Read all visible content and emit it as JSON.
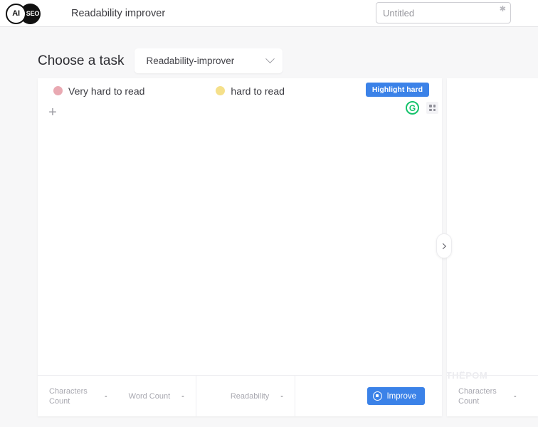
{
  "header": {
    "logo_left": "AI",
    "logo_right": "SEO",
    "title": "Readability improver",
    "document_title_value": "",
    "document_title_placeholder": "Untitled",
    "favorite_icon": "✱"
  },
  "task": {
    "label": "Choose a task",
    "selected": "Readability-improver",
    "dropdown_icon": "chevron-down-icon"
  },
  "editor": {
    "legend": [
      {
        "text": "Very hard to read",
        "color": "#e9a9b2"
      },
      {
        "text": "hard to read",
        "color": "#f5e08a"
      }
    ],
    "highlight_button": "Highlight hard",
    "add_block_icon": "+",
    "grammarly_icon": "G",
    "drag_handle_icon": "grid-handle-icon",
    "content": ""
  },
  "stats": {
    "characters_count_label": "Characters Count",
    "characters_count_value": "-",
    "word_count_label": "Word Count",
    "word_count_value": "-",
    "readability_label": "Readability",
    "readability_value": "-"
  },
  "improve_button": {
    "label": "Improve",
    "icon": "gear-icon"
  },
  "right_panel": {
    "characters_count_label": "Characters Count",
    "characters_count_value": "-",
    "expand_icon": "chevron-right-icon"
  },
  "watermark": {
    "text": "ПАРТНЁРОМ"
  },
  "colors": {
    "accent_blue": "#3b82e8",
    "grammarly_green": "#15c26b",
    "very_hard": "#e9a9b2",
    "hard": "#f5e08a",
    "page_background": "#f7f7f8"
  }
}
